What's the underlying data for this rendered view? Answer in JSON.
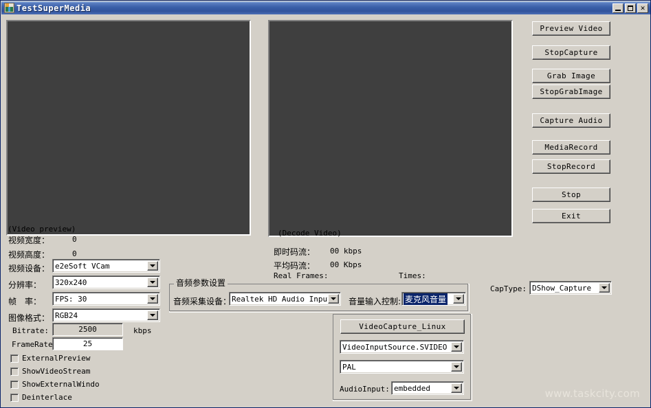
{
  "window": {
    "title": "TestSuperMedia",
    "icon": "app-icon",
    "controls": {
      "minimize": "_",
      "maximize": "□",
      "close": "✕"
    }
  },
  "preview": {
    "left_caption": "(Video preview)",
    "right_caption": "(Decode Video)"
  },
  "video_settings": {
    "width_label": "视频宽度：",
    "width_value": "0",
    "height_label": "视频高度：",
    "height_value": "0",
    "device_label": "视频设备：",
    "device_value": "e2eSoft VCam",
    "resolution_label": "分辨率：",
    "resolution_value": "320x240",
    "fps_label": "帧　率：",
    "fps_value": "FPS: 30",
    "format_label": "图像格式：",
    "format_value": "RGB24",
    "bitrate_label": "Bitrate:",
    "bitrate_value": "2500",
    "bitrate_unit": "kbps",
    "framerate_label": "FrameRate",
    "framerate_value": "25"
  },
  "checkboxes": [
    {
      "label": "ExternalPreview",
      "checked": false
    },
    {
      "label": "ShowVideoStream",
      "checked": false
    },
    {
      "label": "ShowExternalWindo",
      "checked": false
    },
    {
      "label": "Deinterlace",
      "checked": false
    }
  ],
  "decode_stats": {
    "instant_label": "即时码流：",
    "instant_value": "00 kbps",
    "average_label": "平均码流：",
    "average_value": "00 Kbps",
    "real_frames_label": "Real Frames:",
    "real_frames_value": "",
    "times_label": "Times:",
    "times_value": ""
  },
  "audio_group": {
    "legend": "音频参数设置",
    "device_label": "音频采集设备：",
    "device_value": "Realtek HD Audio Input",
    "volume_label": "音量输入控制:",
    "volume_value": "麦克风音量",
    "volume_selected_color": "#0a246a"
  },
  "linux_group": {
    "button_label": "VideoCapture_Linux",
    "input_source_value": "VideoInputSource.SVIDEO",
    "standard_value": "PAL",
    "audio_input_label": "AudioInput:",
    "audio_input_value": "embedded"
  },
  "captype": {
    "label": "CapType:",
    "value": "DShow_Capture"
  },
  "action_buttons": [
    {
      "label": "Preview Video"
    },
    {
      "label": "StopCapture"
    },
    {
      "label": "Grab Image"
    },
    {
      "label": "StopGrabImage"
    },
    {
      "label": "Capture Audio"
    },
    {
      "label": "MediaRecord"
    },
    {
      "label": "StopRecord"
    },
    {
      "label": "Stop"
    },
    {
      "label": "Exit"
    }
  ],
  "watermark": "www.taskcity.com"
}
